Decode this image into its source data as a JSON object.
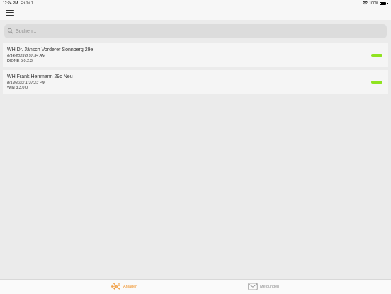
{
  "status_bar": {
    "time": "12:24 PM",
    "date": "Fri Jul 7",
    "battery": "100%"
  },
  "search": {
    "placeholder": "Suchen..."
  },
  "items": [
    {
      "title": "WH Dr. Jänsch Vorderer Sonnberg 29e",
      "date": "6/14/2023 8:57:34 AM",
      "version": "DIONE 5.0.2.3",
      "status_color": "#8fe31f"
    },
    {
      "title": "WH Frank Herrmann 29c Neu",
      "date": "8/19/2022 1:37:23 PM",
      "version": "WIN 3.3.0.0",
      "status_color": "#8fe31f"
    }
  ],
  "tabs": [
    {
      "label": "Anlagen",
      "icon": "network-icon",
      "active": true
    },
    {
      "label": "Meldungen",
      "icon": "mail-icon",
      "active": false
    }
  ],
  "colors": {
    "accent": "#f0932b",
    "status_ok": "#8fe31f",
    "background": "#ebebeb"
  }
}
